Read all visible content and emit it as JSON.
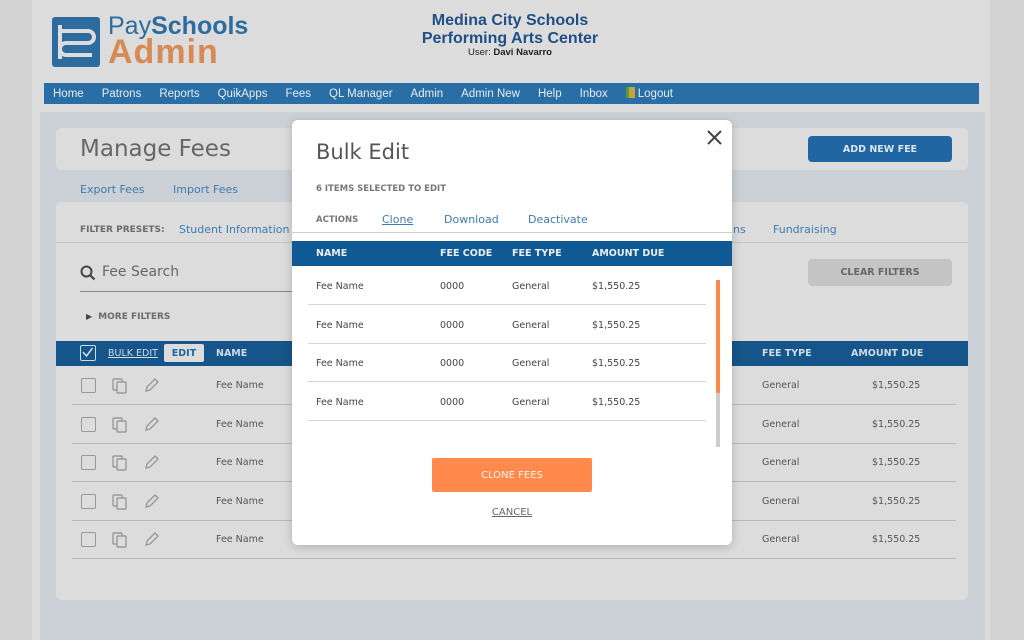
{
  "header": {
    "logo_pay": "Pay",
    "logo_schools": "Schools",
    "logo_admin": "Admin",
    "org_line1": "Medina City Schools",
    "org_line2": "Performing Arts Center",
    "user_label": "User:",
    "user_name": "Davi Navarro"
  },
  "nav": {
    "items": [
      "Home",
      "Patrons",
      "Reports",
      "QuikApps",
      "Fees",
      "QL Manager",
      "Admin",
      "Admin New",
      "Help",
      "Inbox"
    ],
    "logout": "Logout"
  },
  "page": {
    "title": "Manage Fees",
    "add_new_fee": "ADD NEW FEE",
    "export_fees": "Export Fees",
    "import_fees": "Import Fees",
    "filter_presets_label": "FILTER PRESETS:",
    "presets": [
      "Student Information S",
      "ns",
      "Fundraising"
    ],
    "search_placeholder": "Fee Search",
    "clear_filters": "CLEAR FILTERS",
    "more_filters": "MORE FILTERS"
  },
  "table": {
    "bulk_edit": "BULK EDIT",
    "edit": "EDIT",
    "col_name": "NAME",
    "col_fee_type": "FEE TYPE",
    "col_amount_due": "AMOUNT DUE",
    "rows": [
      {
        "name": "Fee Name",
        "type": "General",
        "amount": "$1,550.25"
      },
      {
        "name": "Fee Name",
        "type": "General",
        "amount": "$1,550.25"
      },
      {
        "name": "Fee Name",
        "type": "General",
        "amount": "$1,550.25"
      },
      {
        "name": "Fee Name",
        "type": "General",
        "amount": "$1,550.25"
      },
      {
        "name": "Fee Name",
        "type": "General",
        "amount": "$1,550.25"
      }
    ]
  },
  "modal": {
    "title": "Bulk Edit",
    "selected_text": "6 ITEMS SELECTED TO EDIT",
    "actions_label": "ACTIONS",
    "actions": [
      "Clone",
      "Download",
      "Deactivate"
    ],
    "columns": [
      "NAME",
      "FEE CODE",
      "FEE TYPE",
      "AMOUNT DUE"
    ],
    "rows": [
      {
        "name": "Fee Name",
        "code": "0000",
        "type": "General",
        "amount": "$1,550.25"
      },
      {
        "name": "Fee Name",
        "code": "0000",
        "type": "General",
        "amount": "$1,550.25"
      },
      {
        "name": "Fee Name",
        "code": "0000",
        "type": "General",
        "amount": "$1,550.25"
      },
      {
        "name": "Fee Name",
        "code": "0000",
        "type": "General",
        "amount": "$1,550.25"
      }
    ],
    "primary_button": "CLONE FEES",
    "cancel": "CANCEL"
  },
  "colors": {
    "brand_blue": "#1f66a3",
    "table_header": "#165589",
    "accent_orange": "#ff8a4c"
  }
}
